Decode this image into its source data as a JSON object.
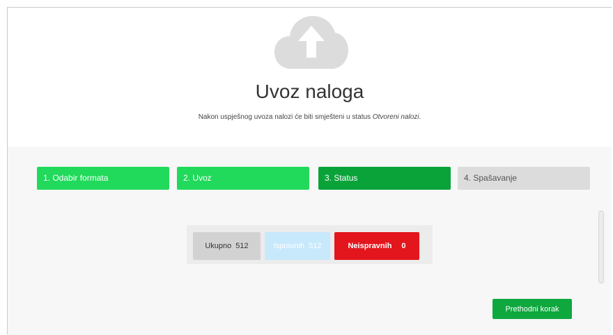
{
  "header": {
    "title": "Uvoz naloga",
    "subtitle_prefix": "Nakon uspješnog uvoza nalozi će biti smješteni u status ",
    "subtitle_status": "Otvoreni nalozi",
    "subtitle_suffix": ".",
    "icon": "cloud-upload-icon"
  },
  "steps": [
    {
      "label": "1. Odabir formata",
      "state": "done"
    },
    {
      "label": "2. Uvoz",
      "state": "done"
    },
    {
      "label": "3. Status",
      "state": "active"
    },
    {
      "label": "4. Spašavanje",
      "state": "todo"
    }
  ],
  "stats": {
    "total_label": "Ukupno",
    "total_value": "512",
    "valid_label": "Ispravnih",
    "valid_value": "512",
    "invalid_label": "Neispravnih",
    "invalid_value": "0"
  },
  "actions": {
    "prev_label": "Prethodni korak"
  },
  "colors": {
    "step_done": "#21d95b",
    "step_active": "#0aa33a",
    "step_todo": "#dcdcdc",
    "invalid": "#e3161d",
    "valid": "#c8e8fb",
    "button": "#0fa83f"
  }
}
